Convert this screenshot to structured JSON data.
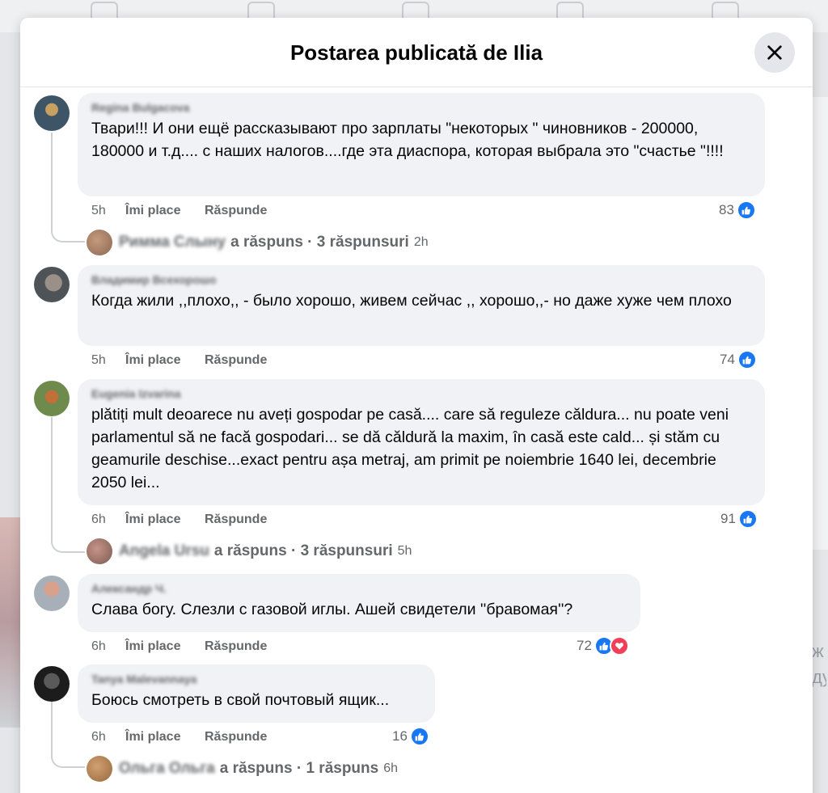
{
  "modal": {
    "title": "Postarea publicată de Ilia"
  },
  "colors": {
    "accent": "#1877f2",
    "love": "#f33e58",
    "bubble": "#f0f2f5",
    "secondary_text": "#65676b"
  },
  "labels": {
    "like": "Îmi place",
    "reply": "Răspunde",
    "replied": "a răspuns"
  },
  "comments": [
    {
      "author": "Regina Bulgacova",
      "text": "Твари!!! И они ещё рассказывают про зарплаты \"некоторых \" чиновников - 200000, 180000 и т.д.... с наших налогов....где эта диаспора, которая выбрала это \"счастье \"!!!!",
      "time": "5h",
      "reactions": "83",
      "reply_author": "Римма Слыну",
      "reply_count": "3 răspunsuri",
      "reply_time": "2h"
    },
    {
      "author": "Владимир Всехорошо",
      "text": "Когда жили ,,плохо,, - было хорошо, живем сейчас ,, хорошо,,- но даже хуже чем плохо",
      "time": "5h",
      "reactions": "74"
    },
    {
      "author": "Eugenia Izvarina",
      "text": "plătiți mult deoarece nu aveți gospodar pe casă.... care să reguleze căldura... nu poate veni parlamentul să ne facă gospodari... se dă căldură la maxim, în casă este cald... și stăm cu geamurile deschise...exact pentru așa metraj, am primit pe noiembrie 1640 lei, decembrie 2050 lei...",
      "time": "6h",
      "reactions": "91",
      "reply_author": "Angela Ursu",
      "reply_count": "3 răspunsuri",
      "reply_time": "5h"
    },
    {
      "author": "Александр Ч.",
      "text": "Слава богу. Слезли с газовой иглы. Ашей свидетели ''бравомая''?",
      "time": "6h",
      "reactions": "72"
    },
    {
      "author": "Tanya Malevannaya",
      "text": "Боюсь смотреть в свой почтовый ящик...",
      "time": "6h",
      "reactions": "16",
      "reply_author": "Ольга Ольга",
      "reply_count": "1 răspuns",
      "reply_time": "6h"
    }
  ],
  "icons": {
    "close": "close-icon",
    "like": "thumbs-up-icon",
    "love": "heart-icon"
  }
}
